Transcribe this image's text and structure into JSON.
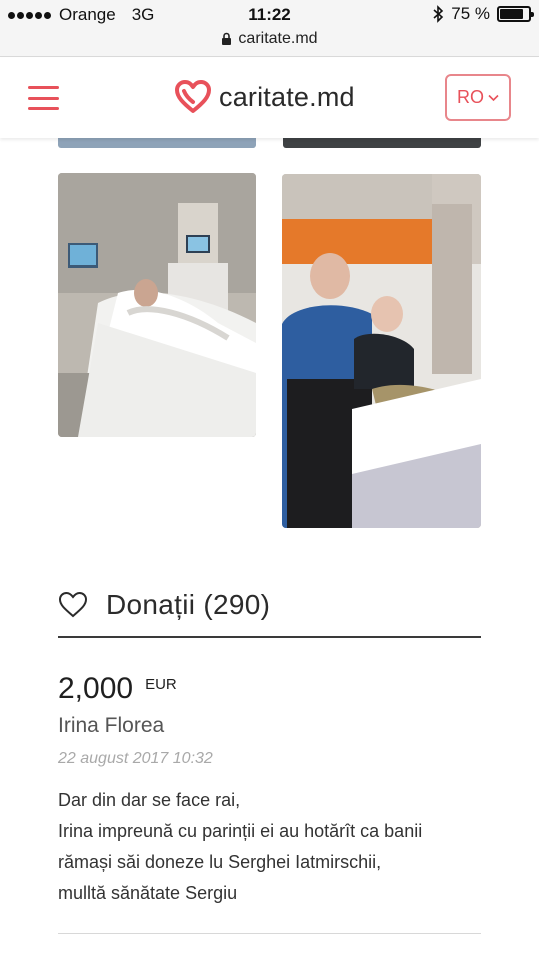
{
  "status_bar": {
    "carrier": "Orange",
    "network": "3G",
    "time": "11:22",
    "battery_percent": "75 %",
    "battery_level": 0.75,
    "url": "caritate.md"
  },
  "header": {
    "logo_text": "caritate.md",
    "language": "RO",
    "accent_color": "#e8515a"
  },
  "gallery": {
    "photos": [
      {
        "alt": ""
      },
      {
        "alt": ""
      }
    ]
  },
  "donations": {
    "title": "Donații (290)",
    "items": [
      {
        "amount": "2,000",
        "currency": "EUR",
        "donor": "Irina Florea",
        "date": "22 august 2017 10:32",
        "message_lines": [
          "Dar din dar se face rai,",
          "Irina impreună cu parinții ei au hotărît ca banii",
          "rămași săi doneze lu Serghei Iatmirschii,",
          "mulltă sănătate Sergiu"
        ]
      }
    ]
  }
}
